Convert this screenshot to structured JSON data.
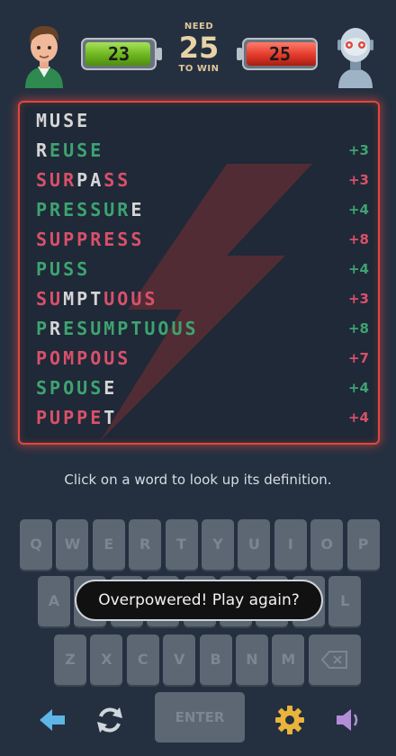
{
  "header": {
    "player_score": "23",
    "opponent_score": "25",
    "need_label": "NEED",
    "need_value": "25",
    "to_win_label": "TO WIN",
    "player_level": 0.92,
    "opponent_level": 1.0
  },
  "words": [
    {
      "letters": [
        [
          "M",
          "w"
        ],
        [
          "U",
          "w"
        ],
        [
          "S",
          "w"
        ],
        [
          "E",
          "w"
        ]
      ],
      "points": "",
      "points_color": "g"
    },
    {
      "letters": [
        [
          "R",
          "w"
        ],
        [
          "E",
          "g"
        ],
        [
          "U",
          "g"
        ],
        [
          "S",
          "g"
        ],
        [
          "E",
          "g"
        ]
      ],
      "points": "+3",
      "points_color": "g"
    },
    {
      "letters": [
        [
          "S",
          "r"
        ],
        [
          "U",
          "r"
        ],
        [
          "R",
          "r"
        ],
        [
          "P",
          "w"
        ],
        [
          "A",
          "w"
        ],
        [
          "S",
          "r"
        ],
        [
          "S",
          "r"
        ]
      ],
      "points": "+3",
      "points_color": "r"
    },
    {
      "letters": [
        [
          "P",
          "g"
        ],
        [
          "R",
          "g"
        ],
        [
          "E",
          "g"
        ],
        [
          "S",
          "g"
        ],
        [
          "S",
          "g"
        ],
        [
          "U",
          "g"
        ],
        [
          "R",
          "g"
        ],
        [
          "E",
          "w"
        ]
      ],
      "points": "+4",
      "points_color": "g"
    },
    {
      "letters": [
        [
          "S",
          "r"
        ],
        [
          "U",
          "r"
        ],
        [
          "P",
          "r"
        ],
        [
          "P",
          "r"
        ],
        [
          "R",
          "r"
        ],
        [
          "E",
          "r"
        ],
        [
          "S",
          "r"
        ],
        [
          "S",
          "r"
        ]
      ],
      "points": "+8",
      "points_color": "r"
    },
    {
      "letters": [
        [
          "P",
          "g"
        ],
        [
          "U",
          "g"
        ],
        [
          "S",
          "g"
        ],
        [
          "S",
          "g"
        ]
      ],
      "points": "+4",
      "points_color": "g"
    },
    {
      "letters": [
        [
          "S",
          "r"
        ],
        [
          "U",
          "r"
        ],
        [
          "M",
          "w"
        ],
        [
          "P",
          "w"
        ],
        [
          "T",
          "w"
        ],
        [
          "U",
          "r"
        ],
        [
          "O",
          "r"
        ],
        [
          "U",
          "r"
        ],
        [
          "S",
          "r"
        ]
      ],
      "points": "+3",
      "points_color": "r"
    },
    {
      "letters": [
        [
          "P",
          "g"
        ],
        [
          "R",
          "w"
        ],
        [
          "E",
          "g"
        ],
        [
          "S",
          "g"
        ],
        [
          "U",
          "g"
        ],
        [
          "M",
          "g"
        ],
        [
          "P",
          "g"
        ],
        [
          "T",
          "g"
        ],
        [
          "U",
          "g"
        ],
        [
          "O",
          "g"
        ],
        [
          "U",
          "g"
        ],
        [
          "S",
          "g"
        ]
      ],
      "points": "+8",
      "points_color": "g"
    },
    {
      "letters": [
        [
          "P",
          "r"
        ],
        [
          "O",
          "r"
        ],
        [
          "M",
          "r"
        ],
        [
          "P",
          "r"
        ],
        [
          "O",
          "r"
        ],
        [
          "U",
          "r"
        ],
        [
          "S",
          "r"
        ]
      ],
      "points": "+7",
      "points_color": "r"
    },
    {
      "letters": [
        [
          "S",
          "g"
        ],
        [
          "P",
          "g"
        ],
        [
          "O",
          "g"
        ],
        [
          "U",
          "g"
        ],
        [
          "S",
          "g"
        ],
        [
          "E",
          "w"
        ]
      ],
      "points": "+4",
      "points_color": "g"
    },
    {
      "letters": [
        [
          "P",
          "r"
        ],
        [
          "U",
          "r"
        ],
        [
          "P",
          "r"
        ],
        [
          "P",
          "r"
        ],
        [
          "E",
          "r"
        ],
        [
          "T",
          "w"
        ]
      ],
      "points": "+4",
      "points_color": "r"
    }
  ],
  "hint": "Click on a word to look up its definition.",
  "keyboard": {
    "row1": [
      "Q",
      "W",
      "E",
      "R",
      "T",
      "Y",
      "U",
      "I",
      "O",
      "P"
    ],
    "row2": [
      "A",
      "S",
      "D",
      "F",
      "G",
      "H",
      "J",
      "K",
      "L"
    ],
    "row3": [
      "Z",
      "X",
      "C",
      "V",
      "B",
      "N",
      "M"
    ],
    "backspace_icon": "backspace-icon",
    "enter_label": "ENTER"
  },
  "toast": "Overpowered! Play again?",
  "colors": {
    "green": "#3ea371",
    "red": "#d9506a",
    "board_border": "#e0483c"
  },
  "icons": [
    "back-arrow-icon",
    "refresh-icon",
    "gear-icon",
    "speaker-icon"
  ]
}
